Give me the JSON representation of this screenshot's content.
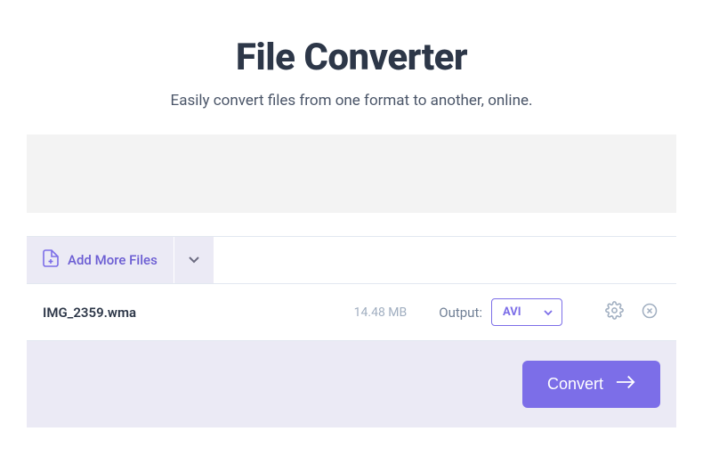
{
  "header": {
    "title": "File Converter",
    "subtitle": "Easily convert files from one format to another, online."
  },
  "toolbar": {
    "add_files_label": "Add More Files"
  },
  "file": {
    "name": "IMG_2359.wma",
    "size": "14.48 MB",
    "output_label": "Output:",
    "format": "AVI"
  },
  "actions": {
    "convert_label": "Convert"
  }
}
